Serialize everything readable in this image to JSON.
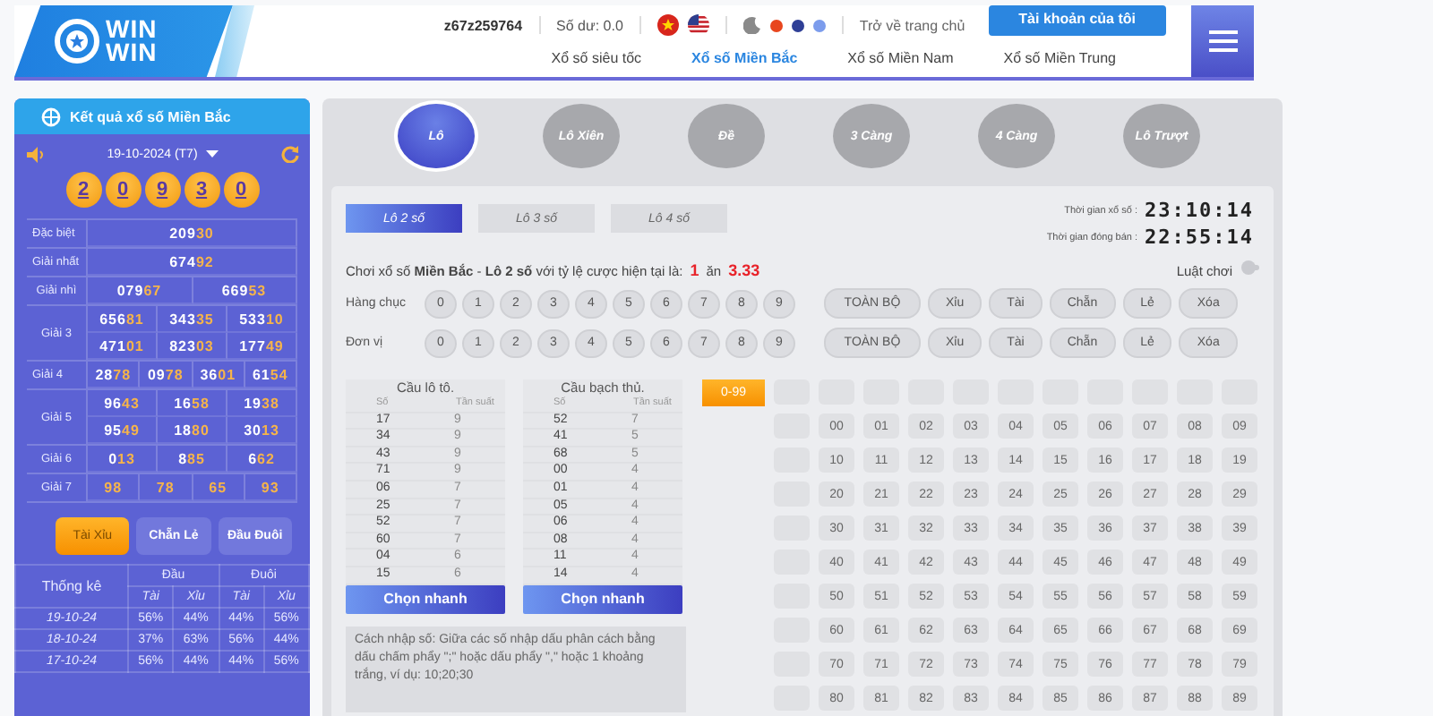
{
  "header": {
    "logo_lines": [
      "WIN",
      "WIN"
    ],
    "username": "z67z259764",
    "balance": "Số dư: 0.0",
    "flags": [
      {
        "kind": "vn"
      },
      {
        "kind": "us"
      }
    ],
    "theme_dots": [
      {
        "color": "#e8461e"
      },
      {
        "color": "#2f3f96"
      },
      {
        "color": "#7c9cec"
      }
    ],
    "home_link": "Trở về trang chủ",
    "account_button": "Tài khoản của tôi",
    "nav": [
      {
        "label": "Xổ số siêu tốc",
        "selected": false
      },
      {
        "label": "Xổ số Miền Bắc",
        "selected": true
      },
      {
        "label": "Xổ số Miền Nam",
        "selected": false
      },
      {
        "label": "Xổ số Miền Trung",
        "selected": false
      }
    ]
  },
  "results": {
    "title": "Kết quả xổ số Miền Bắc",
    "date": "19-10-2024 (T7)",
    "balls": [
      "2",
      "0",
      "9",
      "3",
      "0"
    ],
    "prizes": [
      {
        "label": "Đặc biệt",
        "numbers": [
          {
            "plain": "209",
            "mark": "30"
          }
        ]
      },
      {
        "label": "Giải nhất",
        "numbers": [
          {
            "plain": "674",
            "mark": "92"
          }
        ]
      },
      {
        "label": "Giải nhì",
        "numbers": [
          {
            "plain": "079",
            "mark": "67"
          },
          {
            "plain": "669",
            "mark": "53"
          }
        ]
      },
      {
        "label": "Giải 3",
        "numbers": [
          {
            "plain": "656",
            "mark": "81"
          },
          {
            "plain": "343",
            "mark": "35"
          },
          {
            "plain": "533",
            "mark": "10"
          },
          {
            "plain": "471",
            "mark": "01"
          },
          {
            "plain": "823",
            "mark": "03"
          },
          {
            "plain": "177",
            "mark": "49"
          }
        ]
      },
      {
        "label": "Giải 4",
        "numbers": [
          {
            "plain": "28",
            "mark": "78"
          },
          {
            "plain": "09",
            "mark": "78"
          },
          {
            "plain": "36",
            "mark": "01"
          },
          {
            "plain": "61",
            "mark": "54"
          }
        ]
      },
      {
        "label": "Giải 5",
        "numbers": [
          {
            "plain": "96",
            "mark": "43"
          },
          {
            "plain": "16",
            "mark": "58"
          },
          {
            "plain": "19",
            "mark": "38"
          },
          {
            "plain": "95",
            "mark": "49"
          },
          {
            "plain": "18",
            "mark": "80"
          },
          {
            "plain": "30",
            "mark": "13"
          }
        ]
      },
      {
        "label": "Giải 6",
        "numbers": [
          {
            "plain": "0",
            "mark": "13"
          },
          {
            "plain": "8",
            "mark": "85"
          },
          {
            "plain": "6",
            "mark": "62"
          }
        ]
      },
      {
        "label": "Giải 7",
        "numbers": [
          {
            "mark": "98"
          },
          {
            "mark": "78"
          },
          {
            "mark": "65"
          },
          {
            "mark": "93"
          }
        ]
      }
    ]
  },
  "stats_tabs": [
    {
      "label": "Tài Xỉu",
      "selected": true
    },
    {
      "label": "Chẵn Lẻ",
      "selected": false
    },
    {
      "label": "Đầu Đuôi",
      "selected": false
    }
  ],
  "stats": {
    "title": "Thống kê",
    "groups": [
      "Đầu",
      "Đuôi"
    ],
    "subheads": [
      "Tài",
      "Xỉu",
      "Tài",
      "Xỉu"
    ],
    "rows": [
      {
        "date": "19-10-24",
        "values": [
          "56%",
          "44%",
          "44%",
          "56%"
        ]
      },
      {
        "date": "18-10-24",
        "values": [
          "37%",
          "63%",
          "56%",
          "44%"
        ]
      },
      {
        "date": "17-10-24",
        "values": [
          "56%",
          "44%",
          "44%",
          "56%"
        ]
      }
    ]
  },
  "bet_types": [
    {
      "label": "Lô",
      "selected": true
    },
    {
      "label": "Lô Xiên",
      "selected": false
    },
    {
      "label": "Đề",
      "selected": false
    },
    {
      "label": "3 Càng",
      "selected": false
    },
    {
      "label": "4 Càng",
      "selected": false
    },
    {
      "label": "Lô Trượt",
      "selected": false
    }
  ],
  "sub_tabs": [
    {
      "label": "Lô 2 số",
      "selected": true
    },
    {
      "label": "Lô 3 số",
      "selected": false
    },
    {
      "label": "Lô 4 số",
      "selected": false
    }
  ],
  "timers": [
    {
      "label": "Thời gian xổ số :",
      "value": "23:10:14"
    },
    {
      "label": "Thời gian đóng bán :",
      "value": "22:55:14"
    }
  ],
  "odds": {
    "text": "Chơi xổ số **Miền Bắc** - **Lô 2 số** với tỷ lệ cược hiện tại là:",
    "stake": "1",
    "word": "ăn",
    "payout": "3.33"
  },
  "rules_link": "Luật chơi",
  "digit_rows": [
    {
      "label": "Hàng chục",
      "digits": [
        "0",
        "1",
        "2",
        "3",
        "4",
        "5",
        "6",
        "7",
        "8",
        "9"
      ],
      "actions": [
        "TOÀN BỘ",
        "Xỉu",
        "Tài",
        "Chẵn",
        "Lẻ",
        "Xóa"
      ]
    },
    {
      "label": "Đơn vị",
      "digits": [
        "0",
        "1",
        "2",
        "3",
        "4",
        "5",
        "6",
        "7",
        "8",
        "9"
      ],
      "actions": [
        "TOÀN BỘ",
        "Xỉu",
        "Tài",
        "Chẵn",
        "Lẻ",
        "Xóa"
      ]
    }
  ],
  "frequency_tables": [
    {
      "title": "Cầu lô tô.",
      "columns": [
        "Số",
        "Tần suất"
      ],
      "rows": [
        [
          "17",
          "9"
        ],
        [
          "34",
          "9"
        ],
        [
          "43",
          "9"
        ],
        [
          "71",
          "9"
        ],
        [
          "06",
          "7"
        ],
        [
          "25",
          "7"
        ],
        [
          "52",
          "7"
        ],
        [
          "60",
          "7"
        ],
        [
          "04",
          "6"
        ],
        [
          "15",
          "6"
        ]
      ],
      "button": "Chọn nhanh"
    },
    {
      "title": "Cầu bạch thủ.",
      "columns": [
        "Số",
        "Tần suất"
      ],
      "rows": [
        [
          "52",
          "7"
        ],
        [
          "41",
          "5"
        ],
        [
          "68",
          "5"
        ],
        [
          "00",
          "4"
        ],
        [
          "01",
          "4"
        ],
        [
          "05",
          "4"
        ],
        [
          "06",
          "4"
        ],
        [
          "08",
          "4"
        ],
        [
          "11",
          "4"
        ],
        [
          "14",
          "4"
        ]
      ],
      "button": "Chọn nhanh"
    }
  ],
  "instructions": "Cách nhập số: Giữa các số nhập dấu phân cách bằng dấu chấm phẩy \";\" hoặc dấu phẩy \",\" hoặc 1 khoảng trắng, ví dụ: 10;20;30",
  "number_grid": {
    "range_button": "0-99",
    "rows": [
      [
        "00",
        "01",
        "02",
        "03",
        "04",
        "05",
        "06",
        "07",
        "08",
        "09"
      ],
      [
        "10",
        "11",
        "12",
        "13",
        "14",
        "15",
        "16",
        "17",
        "18",
        "19"
      ],
      [
        "20",
        "21",
        "22",
        "23",
        "24",
        "25",
        "26",
        "27",
        "28",
        "29"
      ],
      [
        "30",
        "31",
        "32",
        "33",
        "34",
        "35",
        "36",
        "37",
        "38",
        "39"
      ],
      [
        "40",
        "41",
        "42",
        "43",
        "44",
        "45",
        "46",
        "47",
        "48",
        "49"
      ],
      [
        "50",
        "51",
        "52",
        "53",
        "54",
        "55",
        "56",
        "57",
        "58",
        "59"
      ],
      [
        "60",
        "61",
        "62",
        "63",
        "64",
        "65",
        "66",
        "67",
        "68",
        "69"
      ],
      [
        "70",
        "71",
        "72",
        "73",
        "74",
        "75",
        "76",
        "77",
        "78",
        "79"
      ],
      [
        "80",
        "81",
        "82",
        "83",
        "84",
        "85",
        "86",
        "87",
        "88",
        "89"
      ]
    ]
  }
}
